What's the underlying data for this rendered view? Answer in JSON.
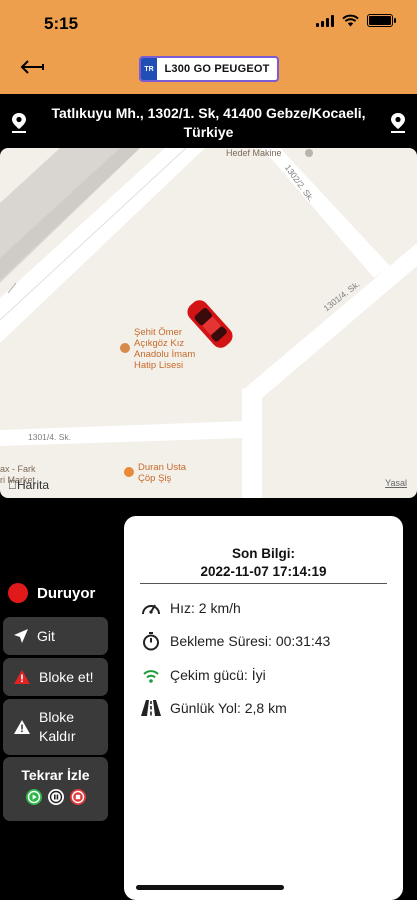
{
  "status_bar": {
    "time": "5:15"
  },
  "header": {
    "plate_flag": "TR",
    "plate": "L300 GO PEUGEOT"
  },
  "address": {
    "line1": "Tatlıkuyu Mh., 1302/1. Sk, 41400 Gebze/Kocaeli,",
    "line2": "Türkiye"
  },
  "map": {
    "labels": {
      "hedef": "Hedef Makine",
      "road_1302_2": "1302/2. Sk.",
      "road_1301_4_right": "1301/4. Sk.",
      "road_1301_4_left": "1301/4. Sk.",
      "poi_school_1": "Şehit Ömer",
      "poi_school_2": "Açıkgöz Kız",
      "poi_school_3": "Anadolu İmam",
      "poi_school_4": "Hatip Lisesi",
      "poi_food_1": "Duran Usta",
      "poi_food_2": "Çöp Şiş",
      "left_partial_1": "ax - Fark",
      "left_partial_2": "ri Market",
      "brand": "Harita",
      "legal": "Yasal"
    }
  },
  "controls": {
    "status": "Duruyor",
    "go": "Git",
    "block": "Bloke et!",
    "unblock_1": "Bloke",
    "unblock_2": "Kaldır",
    "replay": "Tekrar İzle"
  },
  "info": {
    "title": "Son Bilgi:",
    "datetime": "2022-11-07 17:14:19",
    "speed": "Hız: 2  km/h",
    "wait": "Bekleme Süresi: 00:31:43",
    "signal": "Çekim gücü: İyi",
    "daily": "Günlük Yol: 2,8 km"
  },
  "colors": {
    "header": "#ee9f4e",
    "status_red": "#e01a1a",
    "signal_green": "#1e9b3a",
    "replay_green": "#2eb84a",
    "replay_red": "#e0393a"
  }
}
